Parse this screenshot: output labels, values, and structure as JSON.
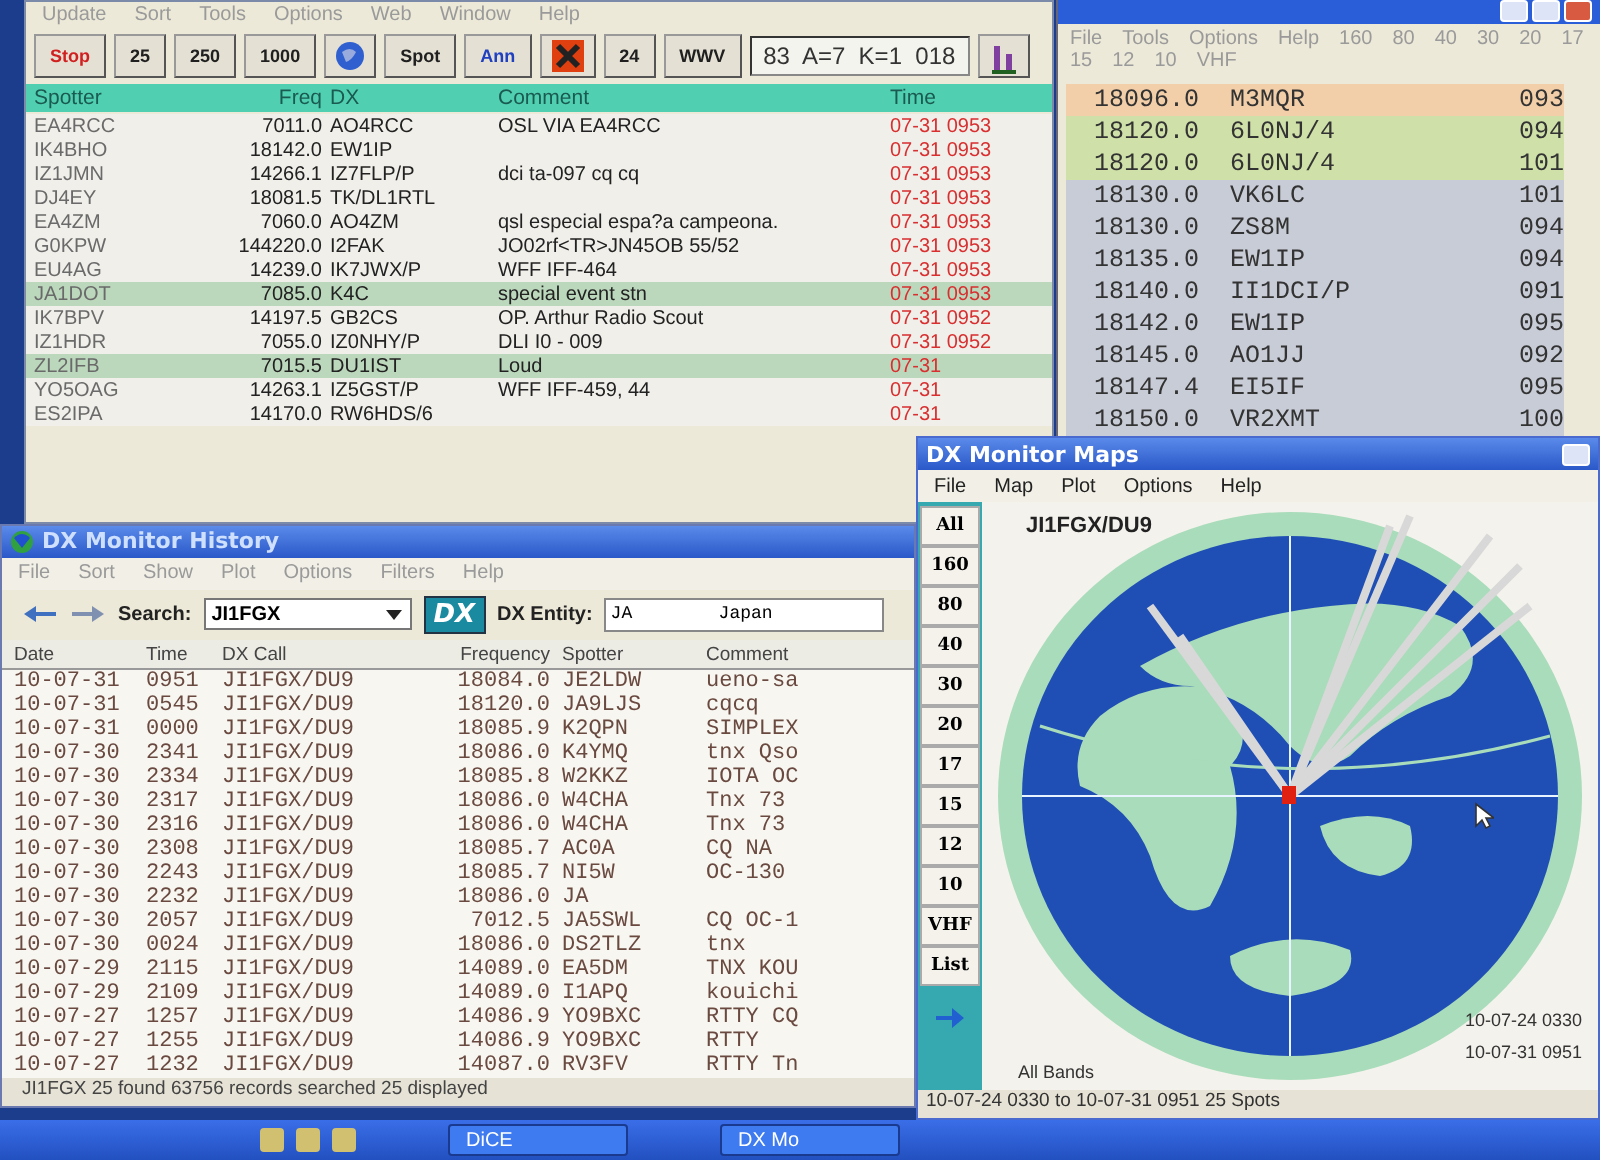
{
  "spots_window": {
    "menu": [
      "Update",
      "Sort",
      "Tools",
      "Options",
      "Web",
      "Window",
      "Help"
    ],
    "toolbar": [
      {
        "kind": "text",
        "label": "Stop",
        "color": "#d02020"
      },
      {
        "kind": "text",
        "label": "25",
        "color": "#202020"
      },
      {
        "kind": "text",
        "label": "250",
        "color": "#202020"
      },
      {
        "kind": "text",
        "label": "1000",
        "color": "#202020"
      },
      {
        "kind": "globe"
      },
      {
        "kind": "text",
        "label": "Spot",
        "color": "#202020"
      },
      {
        "kind": "text",
        "label": "Ann",
        "color": "#2040c0"
      },
      {
        "kind": "burst"
      },
      {
        "kind": "text",
        "label": "24",
        "color": "#202020"
      },
      {
        "kind": "text",
        "label": "WWV",
        "color": "#202020"
      }
    ],
    "solar_readout": "83  A=7  K=1  018",
    "columns": [
      "Spotter",
      "Freq",
      "DX",
      "Comment",
      "Time"
    ],
    "rows": [
      {
        "spotter": "EA4RCC",
        "freq": "7011.0",
        "dx": "AO4RCC",
        "comment": "OSL VIA EA4RCC",
        "time": "07-31 0953",
        "highlighted": false
      },
      {
        "spotter": "IK4BHO",
        "freq": "18142.0",
        "dx": "EW1IP",
        "time": "07-31 0953",
        "highlighted": false
      },
      {
        "spotter": "IZ1JMN",
        "freq": "14266.1",
        "dx": "IZ7FLP/P",
        "comment": "dci ta-097 cq cq",
        "time": "07-31 0953",
        "highlighted": false
      },
      {
        "spotter": "DJ4EY",
        "freq": "18081.5",
        "dx": "TK/DL1RTL",
        "time": "07-31 0953",
        "highlighted": false
      },
      {
        "spotter": "EA4ZM",
        "freq": "7060.0",
        "dx": "AO4ZM",
        "comment": "qsl especial espa?a campeona.",
        "time": "07-31 0953",
        "highlighted": false
      },
      {
        "spotter": "G0KPW",
        "freq": "144220.0",
        "dx": "I2FAK",
        "comment": "JO02rf<TR>JN45OB 55/52",
        "time": "07-31 0953",
        "highlighted": false
      },
      {
        "spotter": "EU4AG",
        "freq": "14239.0",
        "dx": "IK7JWX/P",
        "comment": "WFF IFF-464",
        "time": "07-31 0953",
        "highlighted": false
      },
      {
        "spotter": "JA1DOT",
        "freq": "7085.0",
        "dx": "K4C",
        "comment": "special event stn",
        "time": "07-31 0953",
        "highlighted": true
      },
      {
        "spotter": "IK7BPV",
        "freq": "14197.5",
        "dx": "GB2CS",
        "comment": "OP. Arthur Radio Scout",
        "time": "07-31 0952",
        "highlighted": false
      },
      {
        "spotter": "IZ1HDR",
        "freq": "7055.0",
        "dx": "IZ0NHY/P",
        "comment": "DLI I0 - 009",
        "time": "07-31 0952",
        "highlighted": false
      },
      {
        "spotter": "ZL2IFB",
        "freq": "7015.5",
        "dx": "DU1IST",
        "comment": "Loud",
        "time": "07-31",
        "highlighted": true
      },
      {
        "spotter": "YO5OAG",
        "freq": "14263.1",
        "dx": "IZ5GST/P",
        "comment": "WFF IFF-459, 44",
        "time": "07-31",
        "highlighted": false
      },
      {
        "spotter": "ES2IPA",
        "freq": "14170.0",
        "dx": "RW6HDS/6",
        "time": "07-31",
        "highlighted": false
      }
    ]
  },
  "band_map": {
    "menu": [
      "File",
      "Tools",
      "Options",
      "Help",
      "160",
      "80",
      "40",
      "30",
      "20",
      "17",
      "15",
      "12",
      "10",
      "VHF"
    ],
    "rows": [
      {
        "freq": "18096.0",
        "call": "M3MQR",
        "value": "093",
        "color": "#f2cfa8"
      },
      {
        "freq": "18120.0",
        "call": "6L0NJ/4",
        "value": "094",
        "color": "#cfe0a8"
      },
      {
        "freq": "18120.0",
        "call": "6L0NJ/4",
        "value": "101",
        "color": "#cfe0a8"
      },
      {
        "freq": "18130.0",
        "call": "VK6LC",
        "value": "101",
        "color": "#c8ccd6"
      },
      {
        "freq": "18130.0",
        "call": "ZS8M",
        "value": "094",
        "color": "#c8ccd6"
      },
      {
        "freq": "18135.0",
        "call": "EW1IP",
        "value": "094",
        "color": "#c8ccd6"
      },
      {
        "freq": "18140.0",
        "call": "II1DCI/P",
        "value": "091",
        "color": "#c8ccd6"
      },
      {
        "freq": "18142.0",
        "call": "EW1IP",
        "value": "095",
        "color": "#c8ccd6"
      },
      {
        "freq": "18145.0",
        "call": "AO1JJ",
        "value": "092",
        "color": "#c8ccd6"
      },
      {
        "freq": "18147.4",
        "call": "EI5IF",
        "value": "095",
        "color": "#c8ccd6"
      },
      {
        "freq": "18150.0",
        "call": "VR2XMT",
        "value": "100",
        "color": "#c8ccd6"
      }
    ]
  },
  "history_window": {
    "title": "DX Monitor History",
    "menu": [
      "File",
      "Sort",
      "Show",
      "Plot",
      "Options",
      "Filters",
      "Help"
    ],
    "search_label": "Search:",
    "search_value": "JI1FGX",
    "logo": "DX",
    "entity_label": "DX Entity:",
    "entity_value": "JA        Japan",
    "columns": [
      "Date",
      "Time",
      "DX Call",
      "Frequency",
      "Spotter",
      "Comment"
    ],
    "rows": [
      {
        "date": "10-07-31",
        "time": "0951",
        "call": "JI1FGX/DU9",
        "freq": "18084.0",
        "spotter": "JE2LDW",
        "comment": "ueno-sa"
      },
      {
        "date": "10-07-31",
        "time": "0545",
        "call": "JI1FGX/DU9",
        "freq": "18120.0",
        "spotter": "JA9LJS",
        "comment": "cqcq"
      },
      {
        "date": "10-07-31",
        "time": "0000",
        "call": "JI1FGX/DU9",
        "freq": "18085.9",
        "spotter": "K2QPN",
        "comment": "SIMPLEX"
      },
      {
        "date": "10-07-30",
        "time": "2341",
        "call": "JI1FGX/DU9",
        "freq": "18086.0",
        "spotter": "K4YMQ",
        "comment": "tnx Qso"
      },
      {
        "date": "10-07-30",
        "time": "2334",
        "call": "JI1FGX/DU9",
        "freq": "18085.8",
        "spotter": "W2KKZ",
        "comment": "IOTA OC"
      },
      {
        "date": "10-07-30",
        "time": "2317",
        "call": "JI1FGX/DU9",
        "freq": "18086.0",
        "spotter": "W4CHA",
        "comment": "Tnx 73"
      },
      {
        "date": "10-07-30",
        "time": "2316",
        "call": "JI1FGX/DU9",
        "freq": "18086.0",
        "spotter": "W4CHA",
        "comment": "Tnx 73"
      },
      {
        "date": "10-07-30",
        "time": "2308",
        "call": "JI1FGX/DU9",
        "freq": "18085.7",
        "spotter": "AC0A",
        "comment": "CQ NA"
      },
      {
        "date": "10-07-30",
        "time": "2243",
        "call": "JI1FGX/DU9",
        "freq": "18085.7",
        "spotter": "NI5W",
        "comment": "OC-130"
      },
      {
        "date": "10-07-30",
        "time": "2232",
        "call": "JI1FGX/DU9",
        "freq": "18086.0",
        "spotter": "JA"
      },
      {
        "date": "10-07-30",
        "time": "2057",
        "call": "JI1FGX/DU9",
        "freq": "7012.5",
        "spotter": "JA5SWL",
        "comment": "CQ OC-1"
      },
      {
        "date": "10-07-30",
        "time": "0024",
        "call": "JI1FGX/DU9",
        "freq": "18086.0",
        "spotter": "DS2TLZ",
        "comment": "tnx"
      },
      {
        "date": "10-07-29",
        "time": "2115",
        "call": "JI1FGX/DU9",
        "freq": "14089.0",
        "spotter": "EA5DM",
        "comment": "TNX KOU"
      },
      {
        "date": "10-07-29",
        "time": "2109",
        "call": "JI1FGX/DU9",
        "freq": "14089.0",
        "spotter": "I1APQ",
        "comment": "kouichi"
      },
      {
        "date": "10-07-27",
        "time": "1257",
        "call": "JI1FGX/DU9",
        "freq": "14086.9",
        "spotter": "YO9BXC",
        "comment": "RTTY CQ"
      },
      {
        "date": "10-07-27",
        "time": "1255",
        "call": "JI1FGX/DU9",
        "freq": "14086.9",
        "spotter": "YO9BXC",
        "comment": "RTTY"
      },
      {
        "date": "10-07-27",
        "time": "1232",
        "call": "JI1FGX/DU9",
        "freq": "14087.0",
        "spotter": "RV3FV",
        "comment": "RTTY Tn"
      }
    ],
    "status": "JI1FGX 25 found   63756 records searched   25 displayed"
  },
  "maps_window": {
    "title": "DX Monitor Maps",
    "menu": [
      "File",
      "Map",
      "Plot",
      "Options",
      "Help"
    ],
    "bands": [
      "All",
      "160",
      "80",
      "40",
      "30",
      "20",
      "17",
      "15",
      "12",
      "10",
      "VHF",
      "List"
    ],
    "callsign": "JI1FGX/DU9",
    "band_label": "All Bands",
    "date_from": "10-07-24 0330",
    "date_to": "10-07-31 0951",
    "status": "10-07-24 0330 to 10-07-31 0951 25 Spots"
  },
  "taskbar": {
    "tasks": [
      "DiCE",
      "DX Mo"
    ]
  }
}
